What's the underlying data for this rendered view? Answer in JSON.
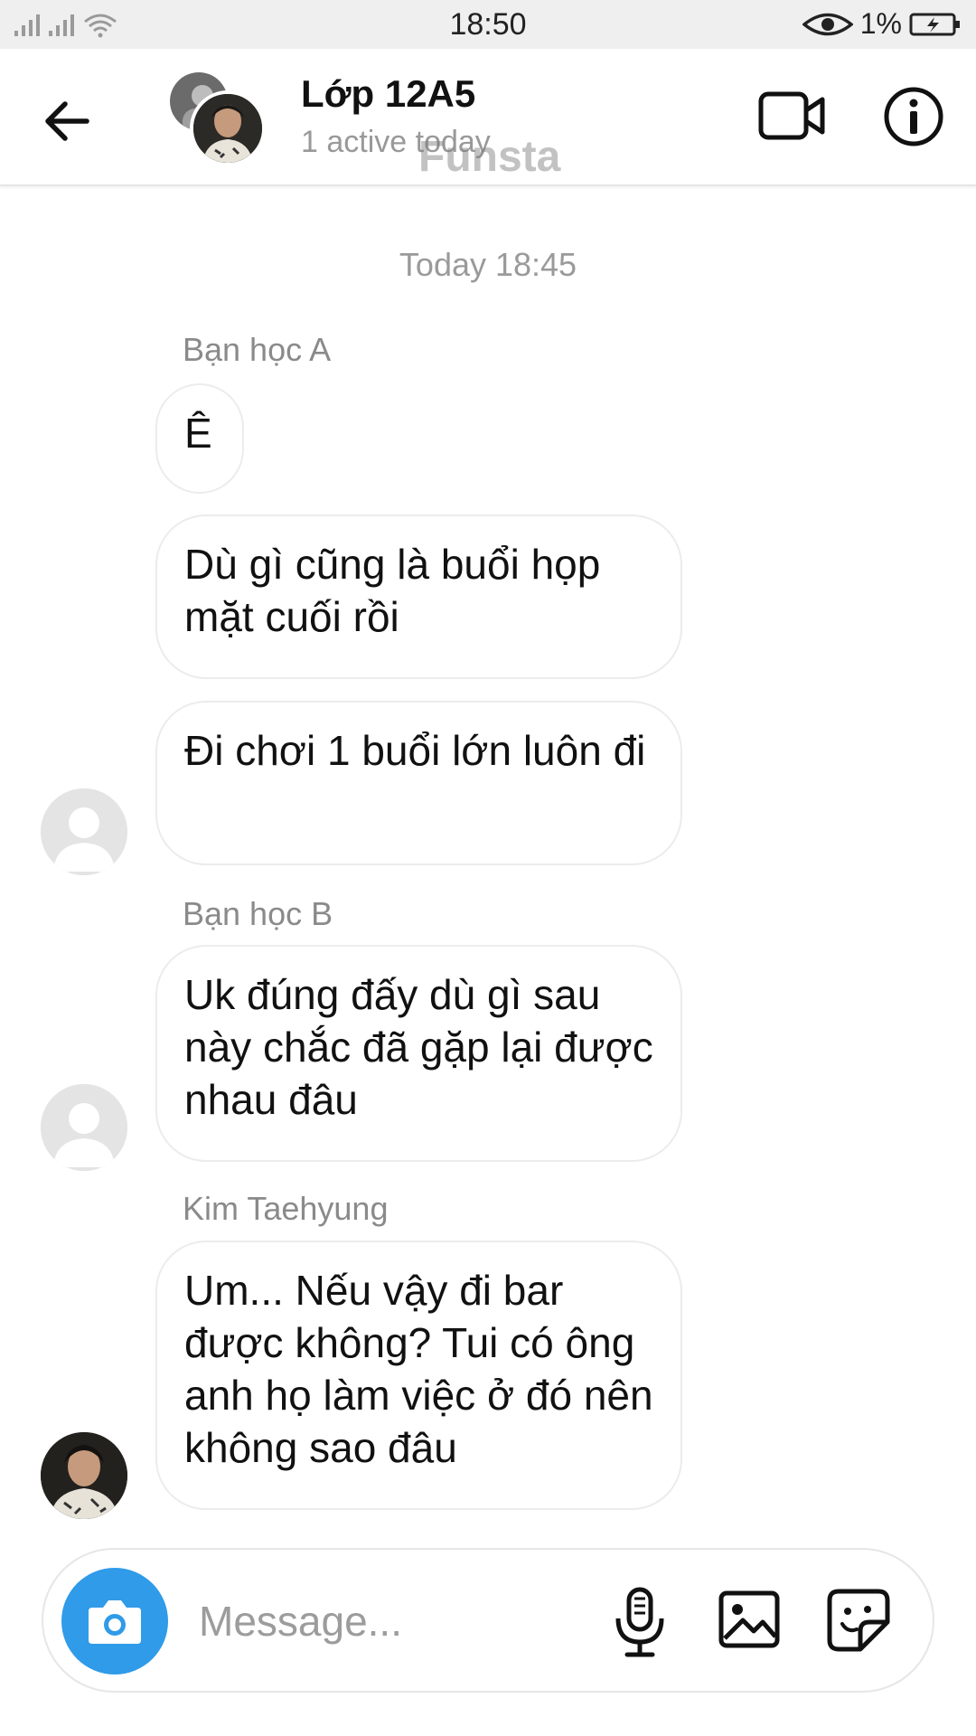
{
  "status_bar": {
    "time": "18:50",
    "battery_percent": "1%",
    "signal_icon": "cell-signal-icon",
    "wifi_icon": "wifi-icon",
    "eye_icon": "eye-comfort-icon",
    "battery_icon": "battery-charging-icon"
  },
  "header": {
    "title": "Lớp 12A5",
    "subtitle": "1 active today",
    "watermark": "Funsta",
    "back_icon": "arrow-left-icon",
    "video_icon": "video-camera-icon",
    "info_icon": "info-icon"
  },
  "chat": {
    "timestamp": "Today 18:45",
    "groups": [
      {
        "sender": "Bạn học A",
        "avatar": "default-avatar",
        "messages": [
          "Ê",
          "Dù gì cũng là buổi họp mặt cuối rồi",
          "Đi chơi 1 buổi lớn luôn đi"
        ]
      },
      {
        "sender": "Bạn học B",
        "avatar": "default-avatar",
        "messages": [
          "Uk đúng đấy dù gì sau này chắc đã gặp lại được nhau đâu"
        ]
      },
      {
        "sender": "Kim Taehyung",
        "avatar": "photo-avatar",
        "messages": [
          "Um...  Nếu vậy đi bar được không? Tui có ông anh họ làm việc ở đó nên không sao đâu"
        ]
      }
    ]
  },
  "composer": {
    "placeholder": "Message...",
    "camera_icon": "camera-icon",
    "mic_icon": "microphone-icon",
    "gallery_icon": "image-icon",
    "sticker_icon": "sticker-icon"
  },
  "colors": {
    "accent_camera": "#2f9be9",
    "status_bar_bg": "#efefef",
    "bubble_border": "#ececec",
    "muted_text": "#9a9a9a"
  }
}
